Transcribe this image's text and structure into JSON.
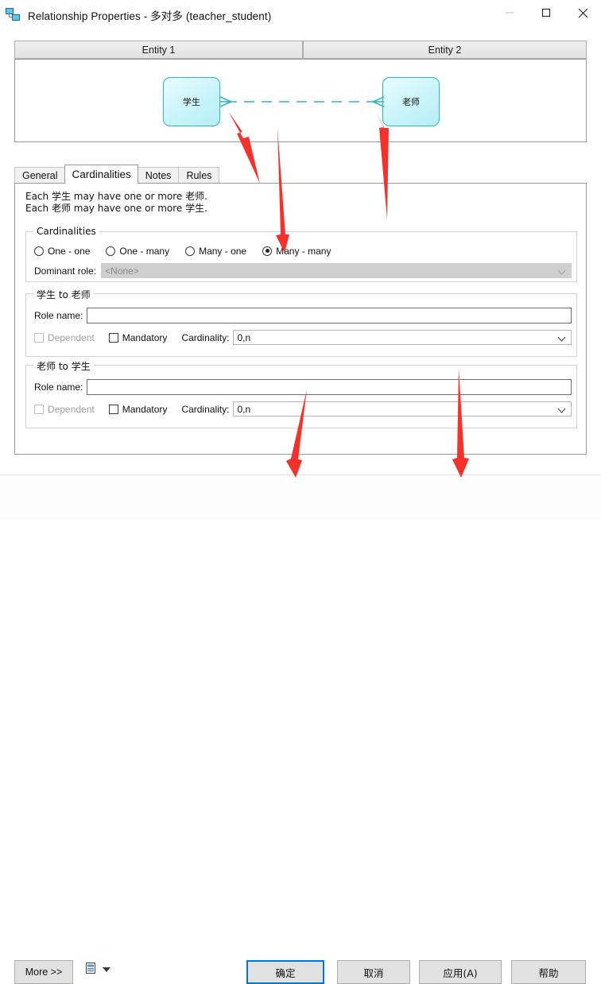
{
  "window": {
    "title": "Relationship Properties - 多对多 (teacher_student)",
    "icon": "relationship-icon",
    "controls": {
      "minimize": "–",
      "maximize": "□",
      "close": "✕"
    }
  },
  "entity_headers": {
    "entity1": "Entity 1",
    "entity2": "Entity 2"
  },
  "diagram": {
    "left_entity": "学生",
    "right_entity": "老师",
    "link_style": "dashed",
    "link_color": "#2bb8c4",
    "left_marker": "crows-foot",
    "right_marker": "crows-foot"
  },
  "tabs": [
    {
      "label": "General",
      "active": false
    },
    {
      "label": "Cardinalities",
      "active": true
    },
    {
      "label": "Notes",
      "active": false
    },
    {
      "label": "Rules",
      "active": false
    }
  ],
  "description": {
    "line1": "Each 学生 may have one or more 老师.",
    "line2": "Each 老师 may have one or more 学生."
  },
  "cardinalities_group": {
    "legend": "Cardinalities",
    "options": [
      {
        "label": "One - one",
        "selected": false
      },
      {
        "label": "One - many",
        "selected": false
      },
      {
        "label": "Many - one",
        "selected": false
      },
      {
        "label": "Many - many",
        "selected": true
      }
    ],
    "dominant_role_label": "Dominant role:",
    "dominant_role_value": "<None>",
    "dominant_role_disabled": true
  },
  "role_a": {
    "legend": "学生 to 老师",
    "role_name_label": "Role name:",
    "role_name_value": "",
    "dependent_label": "Dependent",
    "dependent_checked": false,
    "dependent_disabled": true,
    "mandatory_label": "Mandatory",
    "mandatory_checked": false,
    "cardinality_label": "Cardinality:",
    "cardinality_value": "0,n"
  },
  "role_b": {
    "legend": "老师 to 学生",
    "role_name_label": "Role name:",
    "role_name_value": "",
    "dependent_label": "Dependent",
    "dependent_checked": false,
    "dependent_disabled": true,
    "mandatory_label": "Mandatory",
    "mandatory_checked": false,
    "cardinality_label": "Cardinality:",
    "cardinality_value": "0,n"
  },
  "footer": {
    "more": "More >>",
    "more_chevron": "»",
    "report_icon": "report-icon",
    "report_dropdown_icon": "chevron-down-icon",
    "ok": "确定",
    "cancel": "取消",
    "apply": "应用(A)",
    "help": "帮助",
    "default_button": "确定",
    "focus_color": "#0078d7"
  },
  "annotations": {
    "color": "#f5312c",
    "arrows": [
      {
        "name": "arrow-to-left-crows-foot",
        "points_at": "学生 crow's foot"
      },
      {
        "name": "arrow-to-right-crows-foot",
        "points_at": "老师 crow's foot"
      },
      {
        "name": "arrow-to-many-many-radio",
        "points_at": "Many - many"
      },
      {
        "name": "arrow-to-ok-button",
        "points_at": "确定"
      },
      {
        "name": "arrow-to-apply-button",
        "points_at": "应用(A)"
      }
    ]
  }
}
